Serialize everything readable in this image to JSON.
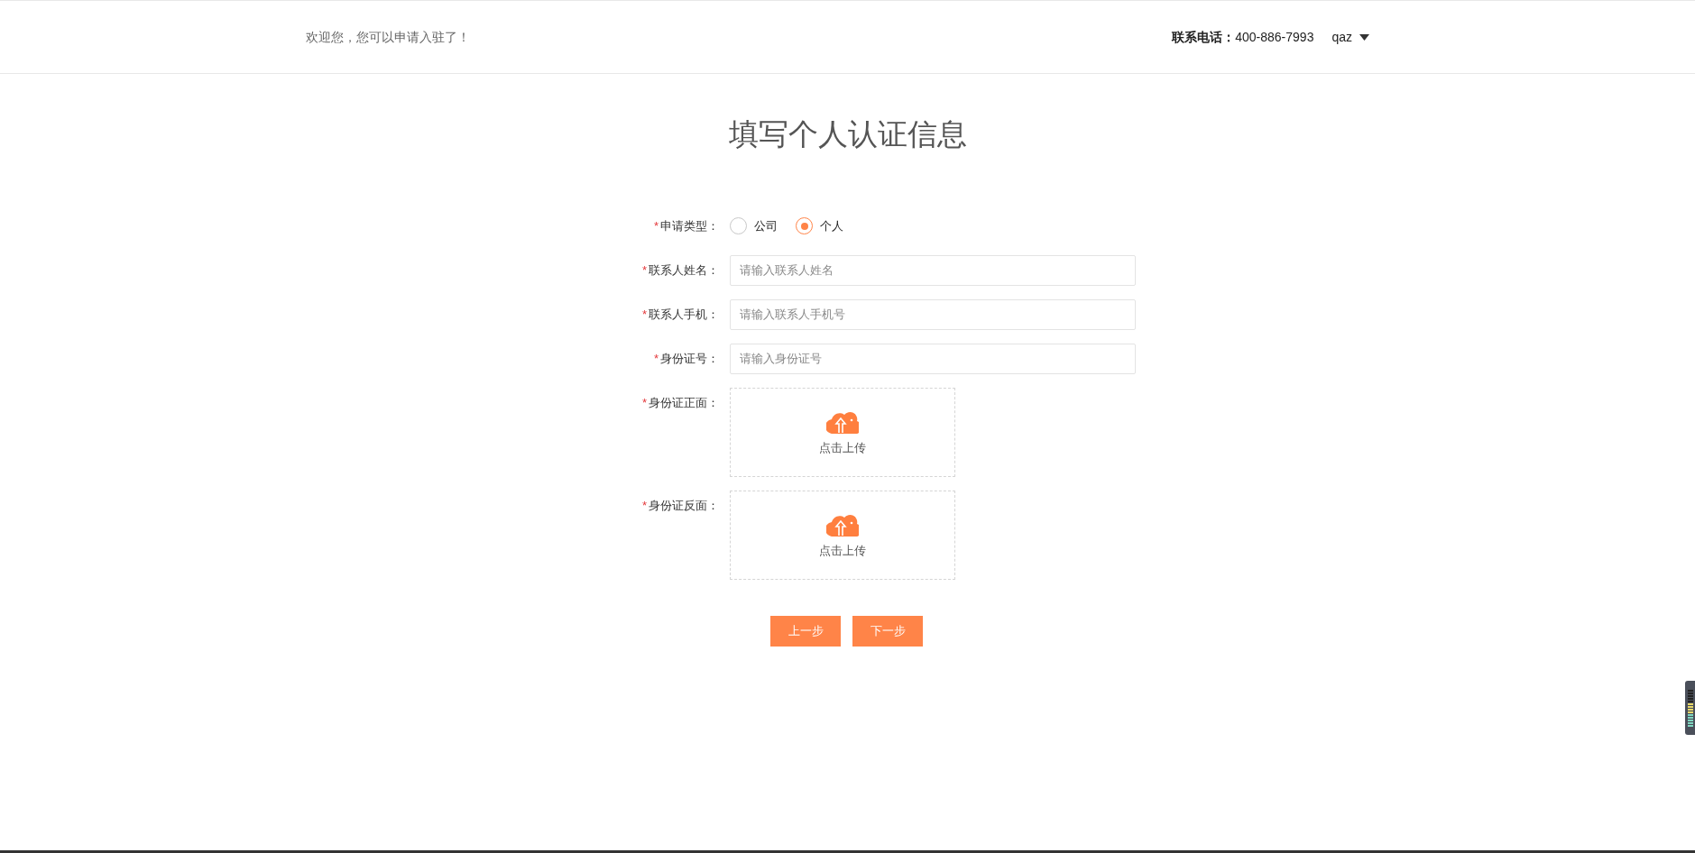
{
  "header": {
    "welcome": "欢迎您，您可以申请入驻了！",
    "phone_label": "联系电话：",
    "phone": "400-886-7993",
    "user": "qaz"
  },
  "title": "填写个人认证信息",
  "fields": [
    {
      "kind": "radio",
      "mark": "*",
      "label": "申请类型：",
      "options": [
        {
          "label": "公司",
          "selected": false
        },
        {
          "label": "个人",
          "selected": true
        }
      ]
    },
    {
      "kind": "input",
      "mark": "*",
      "label": "联系人姓名：",
      "placeholder": "请输入联系人姓名"
    },
    {
      "kind": "input",
      "mark": "*",
      "label": "联系人手机：",
      "placeholder": "请输入联系人手机号"
    },
    {
      "kind": "input",
      "mark": "*",
      "label": "身份证号：",
      "placeholder": "请输入身份证号"
    },
    {
      "kind": "upload",
      "mark": "*",
      "label": "身份证正面：",
      "text": "点击上传"
    },
    {
      "kind": "upload",
      "mark": "*",
      "label": "身份证反面：",
      "text": "点击上传"
    }
  ],
  "buttons": [
    "上一步",
    "下一步"
  ]
}
